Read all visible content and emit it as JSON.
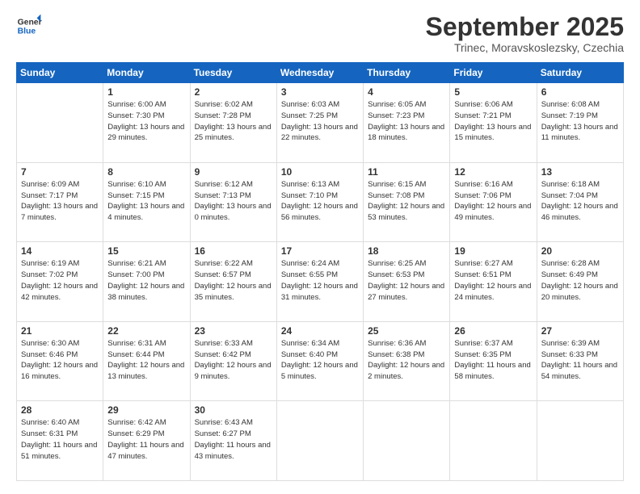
{
  "header": {
    "logo_line1": "General",
    "logo_line2": "Blue",
    "month": "September 2025",
    "location": "Trinec, Moravskoslezsky, Czechia"
  },
  "weekdays": [
    "Sunday",
    "Monday",
    "Tuesday",
    "Wednesday",
    "Thursday",
    "Friday",
    "Saturday"
  ],
  "weeks": [
    [
      {
        "day": "",
        "info": ""
      },
      {
        "day": "1",
        "info": "Sunrise: 6:00 AM\nSunset: 7:30 PM\nDaylight: 13 hours\nand 29 minutes."
      },
      {
        "day": "2",
        "info": "Sunrise: 6:02 AM\nSunset: 7:28 PM\nDaylight: 13 hours\nand 25 minutes."
      },
      {
        "day": "3",
        "info": "Sunrise: 6:03 AM\nSunset: 7:25 PM\nDaylight: 13 hours\nand 22 minutes."
      },
      {
        "day": "4",
        "info": "Sunrise: 6:05 AM\nSunset: 7:23 PM\nDaylight: 13 hours\nand 18 minutes."
      },
      {
        "day": "5",
        "info": "Sunrise: 6:06 AM\nSunset: 7:21 PM\nDaylight: 13 hours\nand 15 minutes."
      },
      {
        "day": "6",
        "info": "Sunrise: 6:08 AM\nSunset: 7:19 PM\nDaylight: 13 hours\nand 11 minutes."
      }
    ],
    [
      {
        "day": "7",
        "info": "Sunrise: 6:09 AM\nSunset: 7:17 PM\nDaylight: 13 hours\nand 7 minutes."
      },
      {
        "day": "8",
        "info": "Sunrise: 6:10 AM\nSunset: 7:15 PM\nDaylight: 13 hours\nand 4 minutes."
      },
      {
        "day": "9",
        "info": "Sunrise: 6:12 AM\nSunset: 7:13 PM\nDaylight: 13 hours\nand 0 minutes."
      },
      {
        "day": "10",
        "info": "Sunrise: 6:13 AM\nSunset: 7:10 PM\nDaylight: 12 hours\nand 56 minutes."
      },
      {
        "day": "11",
        "info": "Sunrise: 6:15 AM\nSunset: 7:08 PM\nDaylight: 12 hours\nand 53 minutes."
      },
      {
        "day": "12",
        "info": "Sunrise: 6:16 AM\nSunset: 7:06 PM\nDaylight: 12 hours\nand 49 minutes."
      },
      {
        "day": "13",
        "info": "Sunrise: 6:18 AM\nSunset: 7:04 PM\nDaylight: 12 hours\nand 46 minutes."
      }
    ],
    [
      {
        "day": "14",
        "info": "Sunrise: 6:19 AM\nSunset: 7:02 PM\nDaylight: 12 hours\nand 42 minutes."
      },
      {
        "day": "15",
        "info": "Sunrise: 6:21 AM\nSunset: 7:00 PM\nDaylight: 12 hours\nand 38 minutes."
      },
      {
        "day": "16",
        "info": "Sunrise: 6:22 AM\nSunset: 6:57 PM\nDaylight: 12 hours\nand 35 minutes."
      },
      {
        "day": "17",
        "info": "Sunrise: 6:24 AM\nSunset: 6:55 PM\nDaylight: 12 hours\nand 31 minutes."
      },
      {
        "day": "18",
        "info": "Sunrise: 6:25 AM\nSunset: 6:53 PM\nDaylight: 12 hours\nand 27 minutes."
      },
      {
        "day": "19",
        "info": "Sunrise: 6:27 AM\nSunset: 6:51 PM\nDaylight: 12 hours\nand 24 minutes."
      },
      {
        "day": "20",
        "info": "Sunrise: 6:28 AM\nSunset: 6:49 PM\nDaylight: 12 hours\nand 20 minutes."
      }
    ],
    [
      {
        "day": "21",
        "info": "Sunrise: 6:30 AM\nSunset: 6:46 PM\nDaylight: 12 hours\nand 16 minutes."
      },
      {
        "day": "22",
        "info": "Sunrise: 6:31 AM\nSunset: 6:44 PM\nDaylight: 12 hours\nand 13 minutes."
      },
      {
        "day": "23",
        "info": "Sunrise: 6:33 AM\nSunset: 6:42 PM\nDaylight: 12 hours\nand 9 minutes."
      },
      {
        "day": "24",
        "info": "Sunrise: 6:34 AM\nSunset: 6:40 PM\nDaylight: 12 hours\nand 5 minutes."
      },
      {
        "day": "25",
        "info": "Sunrise: 6:36 AM\nSunset: 6:38 PM\nDaylight: 12 hours\nand 2 minutes."
      },
      {
        "day": "26",
        "info": "Sunrise: 6:37 AM\nSunset: 6:35 PM\nDaylight: 11 hours\nand 58 minutes."
      },
      {
        "day": "27",
        "info": "Sunrise: 6:39 AM\nSunset: 6:33 PM\nDaylight: 11 hours\nand 54 minutes."
      }
    ],
    [
      {
        "day": "28",
        "info": "Sunrise: 6:40 AM\nSunset: 6:31 PM\nDaylight: 11 hours\nand 51 minutes."
      },
      {
        "day": "29",
        "info": "Sunrise: 6:42 AM\nSunset: 6:29 PM\nDaylight: 11 hours\nand 47 minutes."
      },
      {
        "day": "30",
        "info": "Sunrise: 6:43 AM\nSunset: 6:27 PM\nDaylight: 11 hours\nand 43 minutes."
      },
      {
        "day": "",
        "info": ""
      },
      {
        "day": "",
        "info": ""
      },
      {
        "day": "",
        "info": ""
      },
      {
        "day": "",
        "info": ""
      }
    ]
  ]
}
